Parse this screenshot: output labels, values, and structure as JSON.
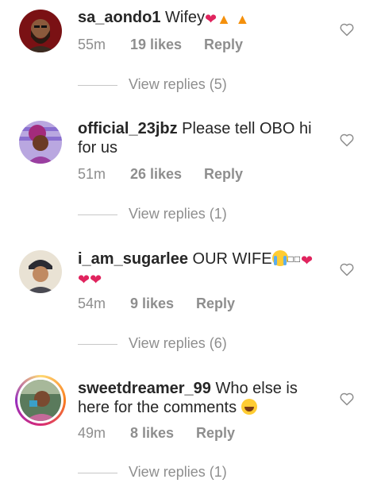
{
  "comments": [
    {
      "username": "sa_aondo1",
      "text": "Wifey",
      "emoji": [
        "red-heart",
        "fire",
        "fire"
      ],
      "time": "55m",
      "likes": "19 likes",
      "reply": "Reply",
      "view_replies": "View replies (5)",
      "avatar_icon": "bearded-man-avatar"
    },
    {
      "username": "official_23jbz",
      "text": "Please tell OBO hi for us",
      "emoji": [],
      "time": "51m",
      "likes": "26 likes",
      "reply": "Reply",
      "view_replies": "View replies (1)",
      "avatar_icon": "woman-illustration-avatar"
    },
    {
      "username": "i_am_sugarlee",
      "text": "OUR WIFE",
      "emoji": [
        "loudly-crying-face",
        "missing-glyph",
        "missing-glyph",
        "red-heart",
        "red-heart",
        "red-heart"
      ],
      "time": "54m",
      "likes": "9 likes",
      "reply": "Reply",
      "view_replies": "View replies (6)",
      "avatar_icon": "person-cap-avatar"
    },
    {
      "username": "sweetdreamer_99",
      "text": "Who else is here for the comments",
      "emoji": [
        "face-with-tears-of-joy"
      ],
      "time": "49m",
      "likes": "8 likes",
      "reply": "Reply",
      "view_replies": "View replies (1)",
      "avatar_icon": "woman-photo-avatar"
    }
  ],
  "icons": {
    "like": "heart-outline-icon"
  },
  "colors": {
    "text": "#262626",
    "muted": "#8e8e8e",
    "heart": "#e0245e"
  }
}
